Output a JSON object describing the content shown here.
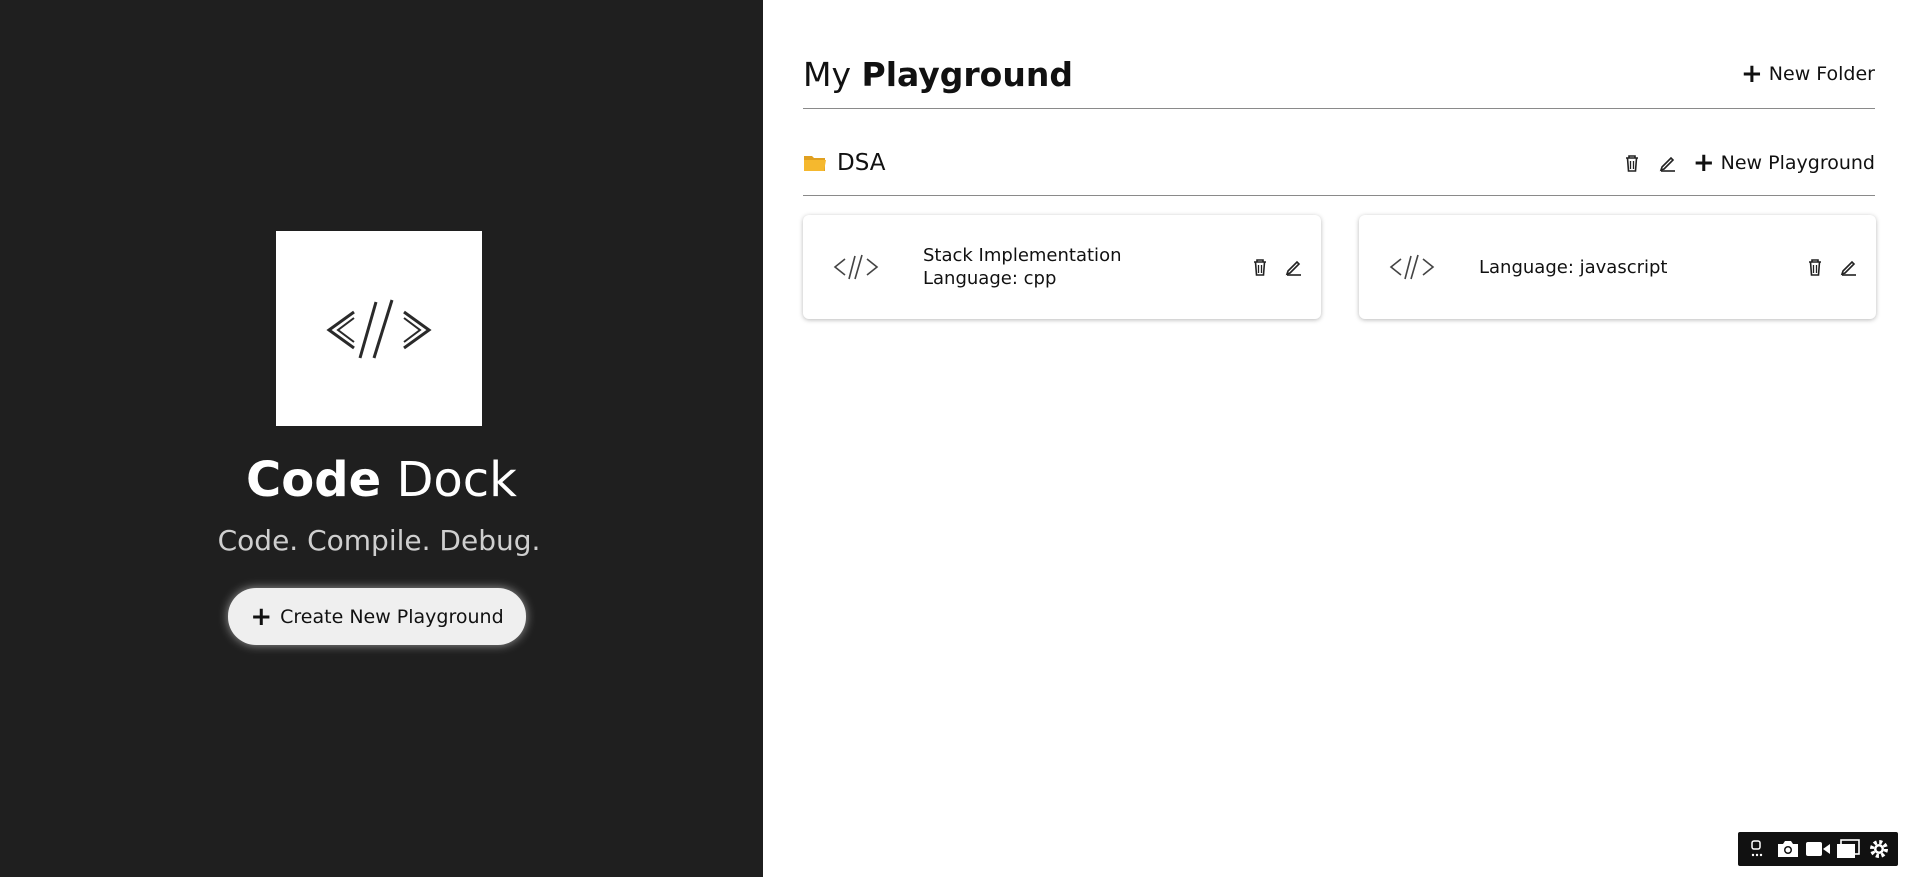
{
  "sidebar": {
    "brand_bold": "Code",
    "brand_light": "Dock",
    "tagline": "Code. Compile. Debug.",
    "create_button_label": "Create New Playground",
    "logo_icon": "code-icon"
  },
  "main": {
    "title_prefix": "My",
    "title_bold": "Playground",
    "new_folder_label": "New Folder",
    "folders": [
      {
        "name": "DSA",
        "new_playground_label": "New Playground",
        "cards": [
          {
            "title": "Stack Implementation",
            "language": "Language: cpp"
          },
          {
            "title": "",
            "language": "Language: javascript"
          }
        ]
      }
    ]
  },
  "colors": {
    "sidebar_bg": "#1f1f1f",
    "folder_icon": "#f5b82e",
    "divider": "#8a8a8a"
  }
}
